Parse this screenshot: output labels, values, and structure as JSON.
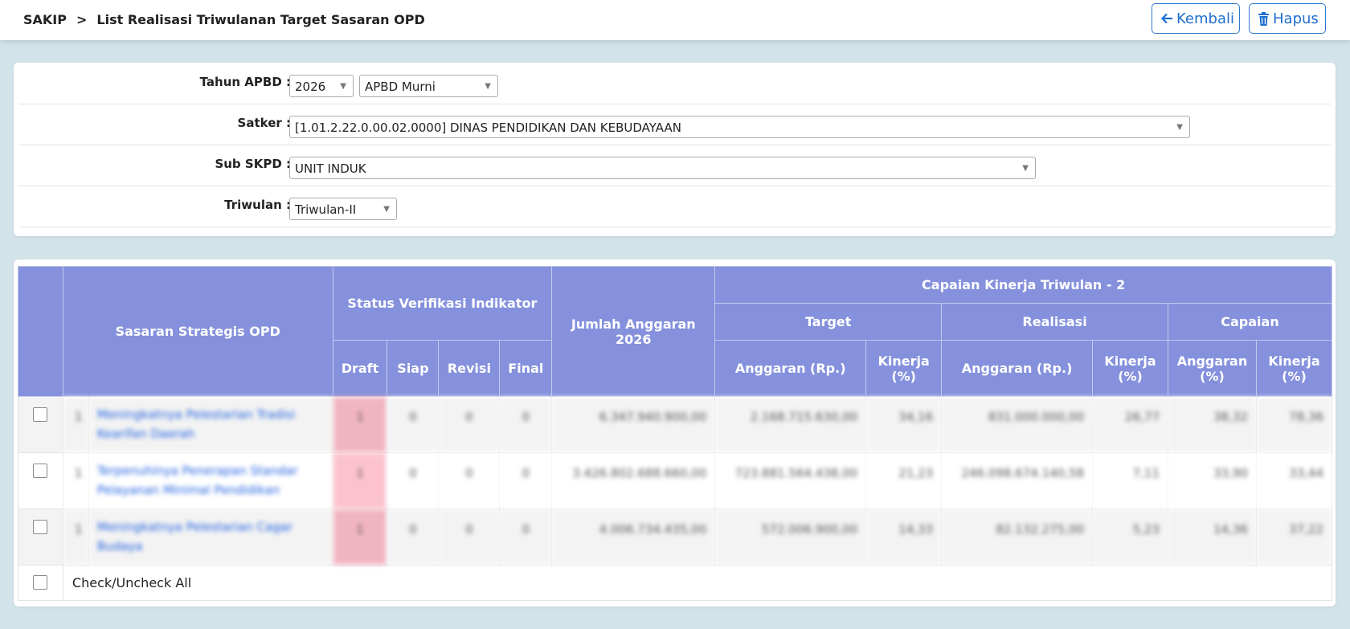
{
  "header": {
    "app": "SAKIP",
    "separator": ">",
    "title": "List Realisasi Triwulanan Target Sasaran OPD",
    "back_label": "Kembali",
    "delete_label": "Hapus"
  },
  "filters": {
    "tahun_label": "Tahun APBD :",
    "tahun_value": "2026",
    "apbd_value": "APBD Murni",
    "satker_label": "Satker :",
    "satker_value": "[1.01.2.22.0.00.02.0000] DINAS PENDIDIKAN DAN KEBUDAYAAN",
    "subskpd_label": "Sub SKPD :",
    "subskpd_value": "UNIT INDUK",
    "triwulan_label": "Triwulan :",
    "triwulan_value": "Triwulan-II"
  },
  "table": {
    "h_sasaran": "Sasaran Strategis OPD",
    "h_status": "Status Verifikasi Indikator",
    "h_draft": "Draft",
    "h_siap": "Siap",
    "h_revisi": "Revisi",
    "h_final": "Final",
    "h_jumlah": "Jumlah Anggaran 2026",
    "h_capaian_kinerja": "Capaian Kinerja Triwulan - 2",
    "h_target": "Target",
    "h_realisasi": "Realisasi",
    "h_capaian": "Capaian",
    "h_anggaran_rp": "Anggaran (Rp.)",
    "h_kinerja_pct": "Kinerja (%)",
    "h_anggaran_pct": "Anggaran (%)",
    "rows": [
      {
        "no": "1",
        "sasaran": "Meningkatnya Pelestarian Tradisi Kearifan Daerah",
        "draft": "1",
        "siap": "0",
        "revisi": "0",
        "final": "0",
        "jumlah": "6.347.940.900,00",
        "target_anggaran": "2.168.715.630,00",
        "target_kinerja": "34,16",
        "realisasi_anggaran": "831.000.000,00",
        "realisasi_kinerja": "26,77",
        "capaian_anggaran": "38,32",
        "capaian_kinerja": "78,36"
      },
      {
        "no": "1",
        "sasaran": "Terpenuhinya Penerapan Standar Pelayanan Minimal Pendidikan",
        "draft": "1",
        "siap": "0",
        "revisi": "0",
        "final": "0",
        "jumlah": "3.426.802.688.660,00",
        "target_anggaran": "723.881.564.438,00",
        "target_kinerja": "21,23",
        "realisasi_anggaran": "246.098.674.140,58",
        "realisasi_kinerja": "7,11",
        "capaian_anggaran": "33,90",
        "capaian_kinerja": "33,44"
      },
      {
        "no": "1",
        "sasaran": "Meningkatnya Pelestarian Cagar Budaya",
        "draft": "1",
        "siap": "0",
        "revisi": "0",
        "final": "0",
        "jumlah": "4.006.734.435,00",
        "target_anggaran": "572.006.900,00",
        "target_kinerja": "14,33",
        "realisasi_anggaran": "82.132.275,00",
        "realisasi_kinerja": "5,23",
        "capaian_anggaran": "14,36",
        "capaian_kinerja": "37,22"
      }
    ],
    "check_all_label": "Check/Uncheck All"
  },
  "colors": {
    "header_bg": "#8591dc",
    "draft_bg": "#f1b5c2",
    "link": "#1d5fe0",
    "button": "#1f6fd0",
    "page_bg": "#d2e3ea"
  }
}
